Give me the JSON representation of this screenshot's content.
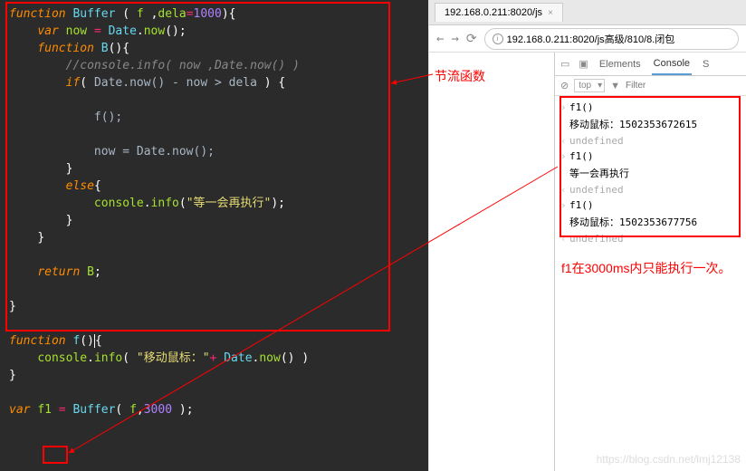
{
  "code": {
    "kw_function": "function",
    "buffer_name": "Buffer",
    "param_f": "f",
    "param_dela": "dela",
    "default_dela": "1000",
    "kw_var": "var",
    "var_now": "now",
    "date_now": "Date",
    "now_method": "now",
    "inner_fn": "B",
    "comment": "//console.info( now ,Date.now() )",
    "kw_if": "if",
    "cond": "Date.now() - now > dela",
    "call_f": "f();",
    "assign_now": "now = Date.now();",
    "kw_else": "else",
    "console": "console",
    "info": "info",
    "wait_str": "\"等一会再执行\"",
    "kw_return": "return",
    "ret_val": "B",
    "f_name": "f",
    "mouse_str": "\"移动鼠标：\"",
    "plus": "+",
    "f1_var": "f1",
    "buffer_call": "Buffer",
    "arg_3000": "3000"
  },
  "browser": {
    "tab_title": "192.168.0.211:8020/js",
    "url": "192.168.0.211:8020/js高级/810/8.闭包"
  },
  "devtools": {
    "tab_elements": "Elements",
    "tab_console": "Console",
    "tab_s": "S",
    "context": "top",
    "filter_placeholder": "Filter",
    "lines": [
      {
        "type": "in",
        "text": "f1()"
      },
      {
        "type": "plain",
        "text": "移动鼠标：1502353672615"
      },
      {
        "type": "out",
        "text": "undefined",
        "cls": "undef"
      },
      {
        "type": "in",
        "text": "f1()"
      },
      {
        "type": "plain",
        "text": "等一会再执行"
      },
      {
        "type": "out",
        "text": "undefined",
        "cls": "undef"
      },
      {
        "type": "in",
        "text": "f1()"
      },
      {
        "type": "plain",
        "text": "移动鼠标：1502353677756"
      },
      {
        "type": "out",
        "text": "undefined",
        "cls": "undef"
      }
    ]
  },
  "annotations": {
    "throttle": "节流函数",
    "f1_note": "f1在3000ms内只能执行一次。"
  },
  "watermark": "https://blog.csdn.net/lmj12138"
}
